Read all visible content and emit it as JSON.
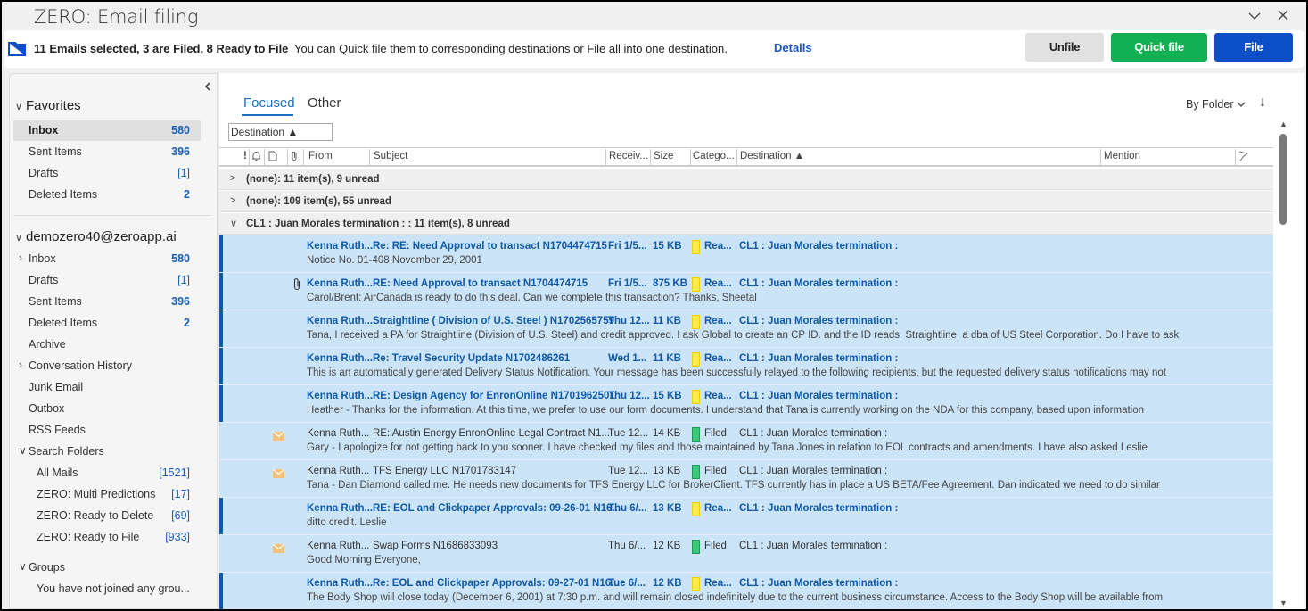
{
  "window": {
    "title": "ZERO: Email filing",
    "minimize_icon": "chevron-down-icon",
    "close_icon": "close-icon"
  },
  "infobar": {
    "icon": "folder-icon",
    "summary": "11 Emails selected, 3 are Filed, 8 Ready to File",
    "message": "You can Quick file them to corresponding destinations or File all into one destination.",
    "details_link": "Details",
    "buttons": {
      "unfile": "Unfile",
      "quick_file": "Quick file",
      "file": "File"
    },
    "colors": {
      "unfile_bg": "#e1e1e1",
      "quick_file_bg": "#12b052",
      "file_bg": "#0d4fc6"
    }
  },
  "sidebar": {
    "collapse_icon": "chevron-left-icon",
    "favorites": {
      "title": "Favorites",
      "items": [
        {
          "label": "Inbox",
          "count": "580",
          "selected": true
        },
        {
          "label": "Sent Items",
          "count": "396"
        },
        {
          "label": "Drafts",
          "count": "[1]"
        },
        {
          "label": "Deleted Items",
          "count": "2"
        }
      ]
    },
    "account": {
      "title": "demozero40@zeroapp.ai",
      "items": [
        {
          "label": "Inbox",
          "count": "580",
          "expandable": true
        },
        {
          "label": "Drafts",
          "count": "[1]"
        },
        {
          "label": "Sent Items",
          "count": "396"
        },
        {
          "label": "Deleted Items",
          "count": "2"
        },
        {
          "label": "Archive",
          "count": ""
        },
        {
          "label": "Conversation History",
          "count": "",
          "expandable": true
        },
        {
          "label": "Junk Email",
          "count": ""
        },
        {
          "label": "Outbox",
          "count": ""
        },
        {
          "label": "RSS Feeds",
          "count": ""
        }
      ]
    },
    "search_folders": {
      "title": "Search Folders",
      "items": [
        {
          "label": "All Mails",
          "count": "[1521]"
        },
        {
          "label": "ZERO: Multi Predictions",
          "count": "[17]"
        },
        {
          "label": "ZERO: Ready to Delete",
          "count": "[69]"
        },
        {
          "label": "ZERO: Ready to File",
          "count": "[933]"
        }
      ]
    },
    "groups": {
      "title": "Groups",
      "empty_text": "You have not joined any grou..."
    }
  },
  "main": {
    "tabs": [
      {
        "label": "Focused",
        "active": true
      },
      {
        "label": "Other",
        "active": false
      }
    ],
    "arrange_by": "Destination ▲",
    "view_option": "By Folder",
    "sort_icon": "arrow-down-icon",
    "columns": {
      "importance": "!",
      "reminder_icon": "bell-icon",
      "type_icon": "document-icon",
      "attachment_icon": "paperclip-icon",
      "from": "From",
      "subject": "Subject",
      "received": "Receiv...",
      "size": "Size",
      "category": "Catego...",
      "destination": "Destination ▲",
      "mention": "Mention",
      "flag_icon": "flag-icon"
    },
    "groups": [
      {
        "label": "(none): 11 item(s), 9 unread",
        "expanded": false
      },
      {
        "label": "(none): 109 item(s), 55 unread",
        "expanded": false
      },
      {
        "label": "CL1 : Juan Morales termination : : 11 item(s), 8 unread",
        "expanded": true
      }
    ],
    "emails": [
      {
        "from": "Kenna Ruth...",
        "subject": "Re: RE: Need Approval to transact N1704474715",
        "received": "Fri 1/5...",
        "size": "15 KB",
        "category": "Rea...",
        "category_color": "#ffe94d",
        "destination": "CL1 : Juan Morales termination :",
        "preview": "Notice No. 01-408  November 29, 2001",
        "unread": true,
        "attachment": false,
        "icon": ""
      },
      {
        "from": "Kenna Ruth...",
        "subject": "RE: Need Approval to transact N1704474715",
        "received": "Fri 1/5...",
        "size": "875 KB",
        "category": "Rea...",
        "category_color": "#ffe94d",
        "destination": "CL1 : Juan Morales termination :",
        "preview": "Carol/Brent:  AirCanada is ready to do this deal.  Can we complete this transaction?  Thanks,  Sheetal",
        "unread": true,
        "attachment": true,
        "icon": ""
      },
      {
        "from": "Kenna Ruth...",
        "subject": "Straightline ( Division of U.S. Steel ) N1702565759",
        "received": "Thu 12...",
        "size": "11 KB",
        "category": "Rea...",
        "category_color": "#ffe94d",
        "destination": "CL1 : Juan Morales termination :",
        "preview": "Tana,  I received a PA for Straightline (Division of U.S. Steel) and credit approved.  I ask Global to create an CP ID.  and the ID reads.  Straightline, a dba of US Steel Corporation.  Do I have to ask",
        "unread": true,
        "attachment": false,
        "icon": ""
      },
      {
        "from": "Kenna Ruth...",
        "subject": "Re: Travel Security Update N1702486261",
        "received": "Wed 1...",
        "size": "11 KB",
        "category": "Rea...",
        "category_color": "#ffe94d",
        "destination": "CL1 : Juan Morales termination :",
        "preview": "This is an automatically generated Delivery Status Notification.  Your message has been successfully relayed to the following recipients, but the requested delivery status notifications may not",
        "unread": true,
        "attachment": false,
        "icon": ""
      },
      {
        "from": "Kenna Ruth...",
        "subject": "RE: Design Agency for EnronOnline N1701962501",
        "received": "Thu 12...",
        "size": "15 KB",
        "category": "Rea...",
        "category_color": "#ffe94d",
        "destination": "CL1 : Juan Morales termination :",
        "preview": "Heather -  Thanks for the information.  At this time, we prefer to use our form documents.  I understand that Tana is currently working on the NDA for this company, based upon information",
        "unread": true,
        "attachment": false,
        "icon": ""
      },
      {
        "from": "Kenna Ruth...",
        "subject": "RE: Austin Energy EnronOnline Legal Contract N1...",
        "received": "Tue 12...",
        "size": "14 KB",
        "category": "Filed",
        "category_color": "#3cc77a",
        "destination": "CL1 : Juan Morales termination :",
        "preview": "Gary -  I apologize for not getting back to you sooner.  I have checked my files and those maintained by Tana Jones in relation to EOL contracts and amendments.  I have also asked Leslie",
        "unread": false,
        "attachment": false,
        "icon": "envelope-open-icon"
      },
      {
        "from": "Kenna Ruth...",
        "subject": "TFS Energy LLC N1701783147",
        "received": "Tue 12...",
        "size": "13 KB",
        "category": "Filed",
        "category_color": "#3cc77a",
        "destination": "CL1 : Juan Morales termination :",
        "preview": "Tana -  Dan Diamond called me.  He needs new documents for TFS Energy LLC for BrokerClient.  TFS currently has in place a US BETA/Fee Agreement.  Dan indicated we need to do similar",
        "unread": false,
        "attachment": false,
        "icon": "envelope-open-icon"
      },
      {
        "from": "Kenna Ruth...",
        "subject": "RE: EOL and Clickpaper Approvals: 09-26-01 N16...",
        "received": "Thu 6/...",
        "size": "13 KB",
        "category": "Rea...",
        "category_color": "#ffe94d",
        "destination": "CL1 : Juan Morales termination :",
        "preview": "ditto credit.  Leslie",
        "unread": true,
        "attachment": false,
        "icon": ""
      },
      {
        "from": "Kenna Ruth...",
        "subject": "Swap Forms N1686833093",
        "received": "Thu 6/...",
        "size": "12 KB",
        "category": "Filed",
        "category_color": "#3cc77a",
        "destination": "CL1 : Juan Morales termination :",
        "preview": "Good Morning Everyone,",
        "unread": false,
        "attachment": false,
        "icon": "envelope-open-icon"
      },
      {
        "from": "Kenna Ruth...",
        "subject": "Re: EOL and Clickpaper Approvals: 09-27-01 N16...",
        "received": "Tue 6/...",
        "size": "12 KB",
        "category": "Rea...",
        "category_color": "#ffe94d",
        "destination": "CL1 : Juan Morales termination :",
        "preview": "The Body Shop will close today (December 6, 2001) at 7:30 p.m. and will remain closed indefinitely due to the current business circumstance.    Access to the Body Shop will be available from",
        "unread": true,
        "attachment": false,
        "icon": ""
      }
    ]
  }
}
